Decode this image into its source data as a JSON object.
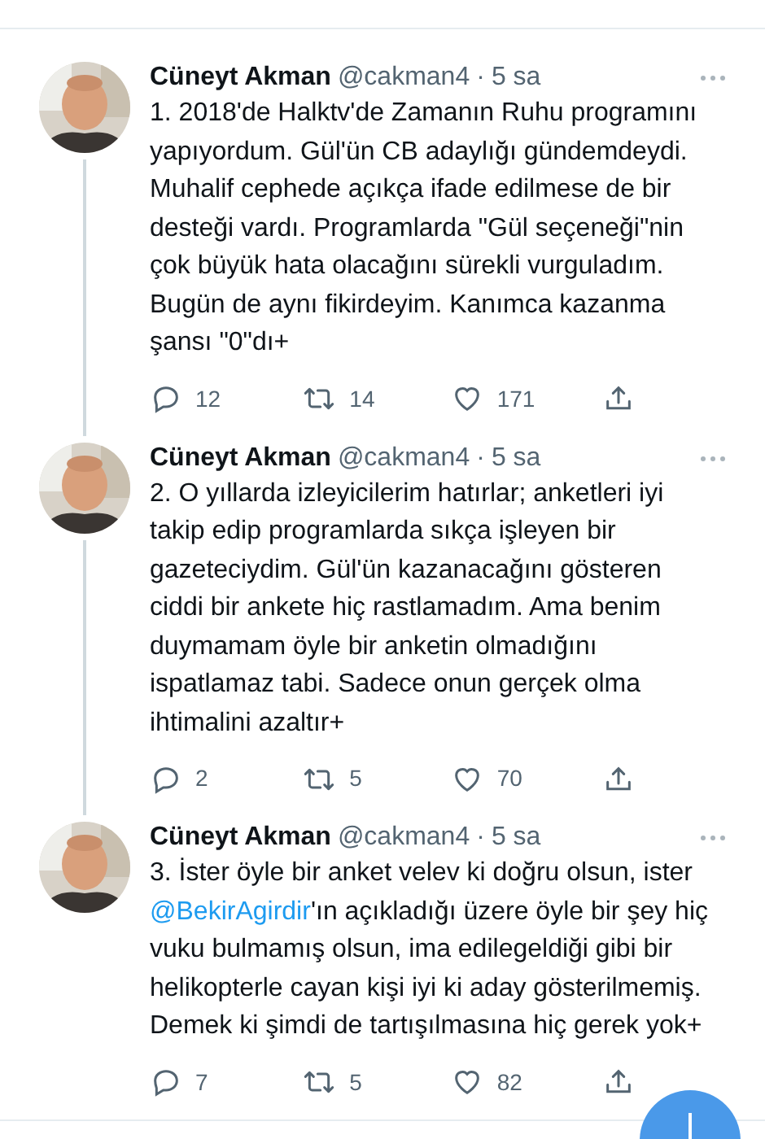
{
  "tweets": [
    {
      "author": "Cüneyt Akman",
      "handle": "@cakman4",
      "separator": "·",
      "time": "5 sa",
      "thread_line": true,
      "segments": [
        {
          "kind": "text",
          "text": "1. 2018'de Halktv'de Zamanın Ruhu programını yapıyordum. Gül'ün CB adaylığı gündemdeydi. Muhalif cephede açıkça ifade edilmese de bir desteği vardı. Programlarda \"Gül seçeneği\"nin çok büyük hata olacağını sürekli vurguladım. Bugün de aynı fikirdeyim. Kanımca kazanma şansı \"0\"dı+"
        }
      ],
      "replies": "12",
      "retweets": "14",
      "likes": "171"
    },
    {
      "author": "Cüneyt Akman",
      "handle": "@cakman4",
      "separator": "·",
      "time": "5 sa",
      "thread_line": true,
      "segments": [
        {
          "kind": "text",
          "text": "2. O yıllarda izleyicilerim hatırlar; anketleri iyi takip edip programlarda sıkça işleyen bir gazeteciydim. Gül'ün kazanacağını gösteren ciddi bir ankete hiç rastlamadım. Ama benim duymamam öyle bir anketin olmadığını ispatlamaz tabi. Sadece onun gerçek olma ihtimalini azaltır+"
        }
      ],
      "replies": "2",
      "retweets": "5",
      "likes": "70"
    },
    {
      "author": "Cüneyt Akman",
      "handle": "@cakman4",
      "separator": "·",
      "time": "5 sa",
      "thread_line": false,
      "segments": [
        {
          "kind": "text",
          "text": "3. İster öyle bir anket velev ki doğru olsun, ister "
        },
        {
          "kind": "mention",
          "text": "@BekirAgirdir"
        },
        {
          "kind": "text",
          "text": "'ın açıkladığı üzere öyle bir şey hiç vuku bulmamış olsun, ima edilegeldiği gibi bir helikopterle cayan kişi iyi ki aday gösterilmemiş. Demek ki şimdi de tartışılmasına hiç gerek yok+"
        }
      ],
      "replies": "7",
      "retweets": "5",
      "likes": "82"
    }
  ]
}
